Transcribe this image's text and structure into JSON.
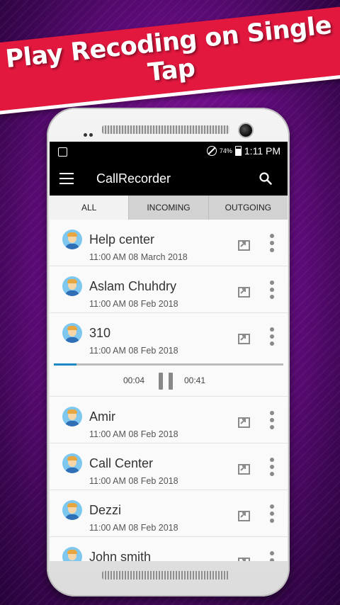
{
  "banner": {
    "text": "Play Recoding on Single Tap"
  },
  "status_bar": {
    "battery": "74%",
    "time": "1:11 PM"
  },
  "app_bar": {
    "title": "CallRecorder"
  },
  "tabs": [
    {
      "label": "ALL",
      "active": true
    },
    {
      "label": "INCOMING",
      "active": false
    },
    {
      "label": "OUTGOING",
      "active": false
    }
  ],
  "recordings": [
    {
      "name": "Help center",
      "time": "11:00 AM 08 March 2018"
    },
    {
      "name": "Aslam Chuhdry",
      "time": "11:00 AM 08 Feb 2018"
    },
    {
      "name": "310",
      "time": "11:00 AM 08 Feb 2018"
    },
    {
      "name": "Amir",
      "time": "11:00 AM 08 Feb 2018"
    },
    {
      "name": "Call Center",
      "time": "11:00 AM 08 Feb 2018"
    },
    {
      "name": "Dezzi",
      "time": "11:00 AM 08 Feb 2018"
    },
    {
      "name": "John smith",
      "time": ""
    }
  ],
  "player": {
    "current": "00:04",
    "duration": "00:41",
    "progress": 0.1
  },
  "colors": {
    "accent": "#1e88c7",
    "banner": "#e2183f",
    "appbar": "#000000"
  }
}
